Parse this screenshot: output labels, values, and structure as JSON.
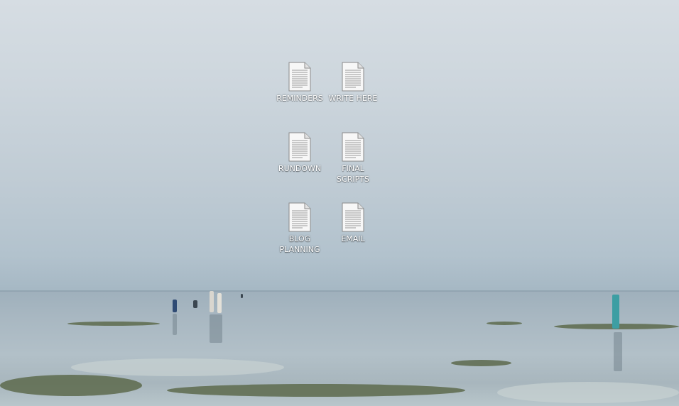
{
  "desktop": {
    "icons": [
      {
        "label": "REMINDERS",
        "icon": "text-document-icon"
      },
      {
        "label": "WRITE HERE",
        "icon": "text-document-icon"
      },
      {
        "label": "RUNDOWN",
        "icon": "text-document-icon"
      },
      {
        "label": "FINAL\nSCRIPTS",
        "icon": "text-document-icon"
      },
      {
        "label": "BLOG\nPLANNING",
        "icon": "text-document-icon"
      },
      {
        "label": "EMAIL",
        "icon": "text-document-icon"
      }
    ]
  },
  "colors": {
    "sky": "#cdd6dd",
    "sea": "#a9b8c2",
    "seaweed": "#5d6a4c",
    "label_text": "#ffffff"
  }
}
